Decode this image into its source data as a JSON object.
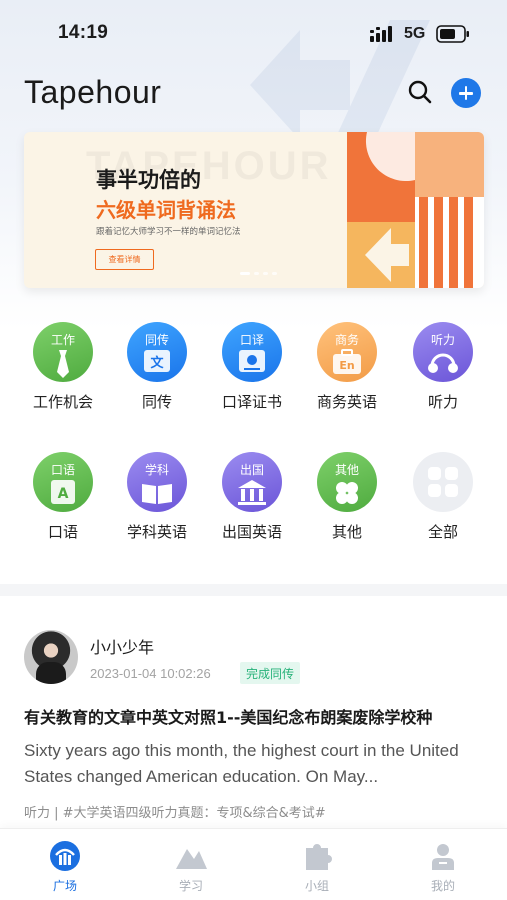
{
  "status_bar": {
    "time": "14:19",
    "network": "5G"
  },
  "header": {
    "title": "Tapehour"
  },
  "banner": {
    "watermark": "TAPEHOUR",
    "headline": "事半功倍的",
    "subhead": "六级单词背诵法",
    "note": "跟着记忆大师学习不一样的单词记忆法",
    "cta": "查看详情"
  },
  "categories": [
    {
      "label": "工作机会",
      "tag": "工作",
      "color": "green",
      "icon": "tie-icon"
    },
    {
      "label": "同传",
      "tag": "同传",
      "color": "blue",
      "icon": "translate-icon"
    },
    {
      "label": "口译证书",
      "tag": "口译",
      "color": "blue",
      "icon": "certificate-icon"
    },
    {
      "label": "商务英语",
      "tag": "商务",
      "color": "orange",
      "icon": "briefcase-icon"
    },
    {
      "label": "听力",
      "tag": "听力",
      "color": "purple",
      "icon": "headphones-icon"
    },
    {
      "label": "口语",
      "tag": "口语",
      "color": "green",
      "icon": "speech-icon"
    },
    {
      "label": "学科英语",
      "tag": "学科",
      "color": "purple",
      "icon": "book-icon"
    },
    {
      "label": "出国英语",
      "tag": "出国",
      "color": "purple",
      "icon": "building-icon"
    },
    {
      "label": "其他",
      "tag": "其他",
      "color": "green",
      "icon": "clover-icon"
    },
    {
      "label": "全部",
      "tag": "",
      "color": "grey",
      "icon": "grid-icon"
    }
  ],
  "post": {
    "author": "小小少年",
    "time": "2023-01-04 10:02:26",
    "badge": "完成同传",
    "title": "有关教育的文章中英文对照1--美国纪念布朗案废除学校种",
    "excerpt": "Sixty years ago this month, the highest court in the United States changed American education. On May...",
    "tags": "听力 | #大学英语四级听力真题：专项&综合&考试#"
  },
  "tabs": [
    {
      "label": "广场",
      "icon": "plaza-icon",
      "active": true
    },
    {
      "label": "学习",
      "icon": "mountain-icon",
      "active": false
    },
    {
      "label": "小组",
      "icon": "puzzle-icon",
      "active": false
    },
    {
      "label": "我的",
      "icon": "profile-icon",
      "active": false
    }
  ],
  "colors": {
    "accent": "#1f78e8",
    "banner_orange": "#ef6a1f",
    "badge_green": "#27b27a"
  }
}
